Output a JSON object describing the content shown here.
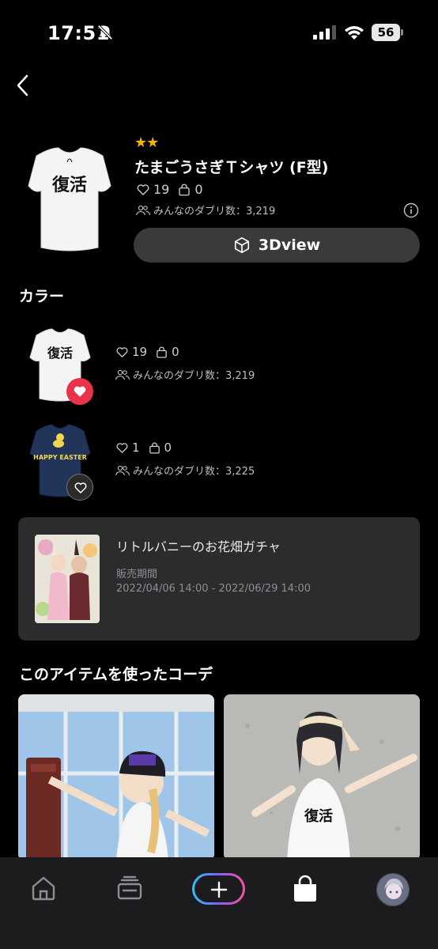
{
  "status_bar": {
    "time": "17:51",
    "battery": "56"
  },
  "product": {
    "stars": "★★",
    "title": "たまごうさぎＴシャツ (F型)",
    "likes": "19",
    "owned": "0",
    "dubs": "みんなのダブリ数：3,219",
    "button_3d": "3Dview"
  },
  "colors_section": {
    "title": "カラー",
    "items": [
      {
        "likes": "19",
        "owned": "0",
        "dubs": "みんなのダブリ数：3,219",
        "favorited": true
      },
      {
        "likes": "1",
        "owned": "0",
        "dubs": "みんなのダブリ数：3,225",
        "favorited": false
      }
    ]
  },
  "gacha": {
    "name": "リトルバニーのお花畑ガチャ",
    "period_label": "販売期間",
    "period": "2022/04/06 14:00 - 2022/06/29 14:00"
  },
  "coords_section": {
    "title": "このアイテムを使ったコーデ"
  },
  "shirt_print": "復活",
  "shirt_print_2": "HAPPY EASTER",
  "nav": {
    "items": [
      "home-icon",
      "collection-icon",
      "create-icon",
      "shop-icon",
      "avatar"
    ]
  },
  "colors": {
    "accent_heart": "#e8334a",
    "star": "#f5b301",
    "card_bg": "#2c2c2e"
  }
}
